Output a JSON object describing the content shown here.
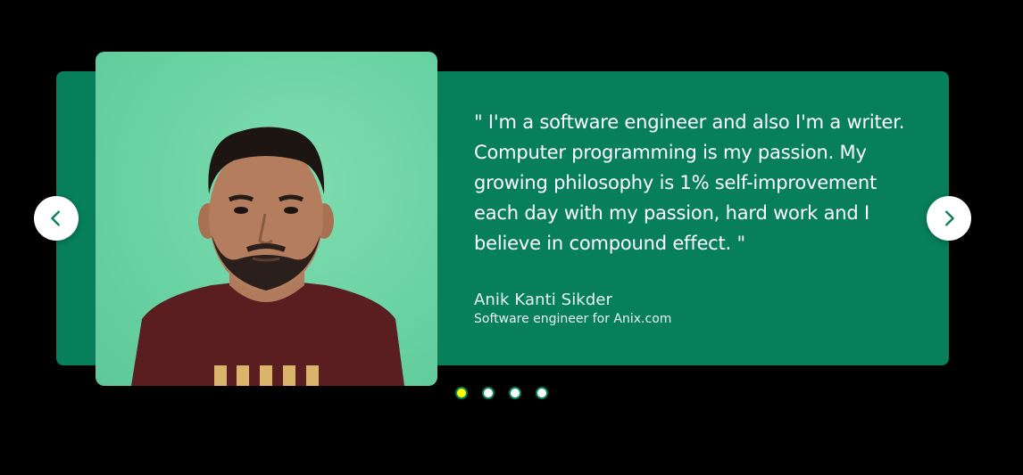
{
  "testimonial": {
    "quote": "\" I'm a software engineer and also I'm a writer. Computer programming is my passion. My growing philosophy is 1% self-improvement each day with my passion, hard work and I believe in compound effect. \"",
    "author_name": "Anik Kanti Sikder",
    "author_role": "Software engineer for Anix.com",
    "photo_icon": "person-portrait"
  },
  "navigation": {
    "prev_icon": "chevron-left-icon",
    "next_icon": "chevron-right-icon"
  },
  "pagination": {
    "total": 4,
    "active_index": 0
  },
  "colors": {
    "background": "#000000",
    "card": "#077f5b",
    "photo_background": "#6ad3a3",
    "active_dot": "#ffff00",
    "dot": "#ffffff"
  }
}
